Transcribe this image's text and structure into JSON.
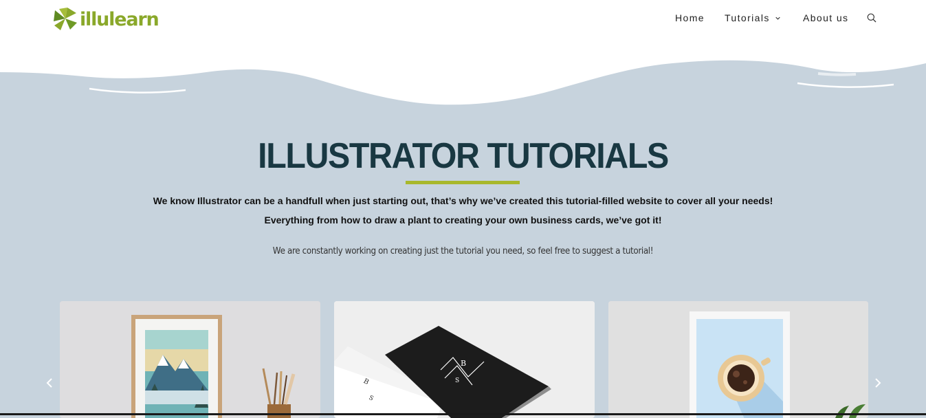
{
  "header": {
    "logo_text": "illulearn",
    "nav": {
      "home": "Home",
      "tutorials": "Tutorials",
      "about": "About us"
    },
    "icons": {
      "search": "search-icon",
      "dropdown": "chevron-down-icon"
    }
  },
  "hero": {
    "title": "ILLUSTRATOR TUTORIALS",
    "lead_line1": "We know Illustrator can be a handfull when just starting out, that’s why we’ve created this tutorial-filled website to cover all your needs!",
    "lead_line2": "Everything from how to draw a plant to creating your own business cards, we’ve got it!",
    "sub": "We are constantly working on creating just the tutorial you need, so feel free to suggest a tutorial!"
  },
  "carousel": {
    "cards": [
      {
        "subject": "framed mountain landscape print with paint brushes"
      },
      {
        "subject": "black and white business cards"
      },
      {
        "subject": "framed coffee cup illustration"
      }
    ],
    "prev_icon": "chevron-left-icon",
    "next_icon": "chevron-right-icon"
  },
  "colors": {
    "brand_green": "#8aa82a",
    "accent_underline": "#a8b82c",
    "title": "#193842",
    "hero_bg": "#c7d3dd"
  }
}
